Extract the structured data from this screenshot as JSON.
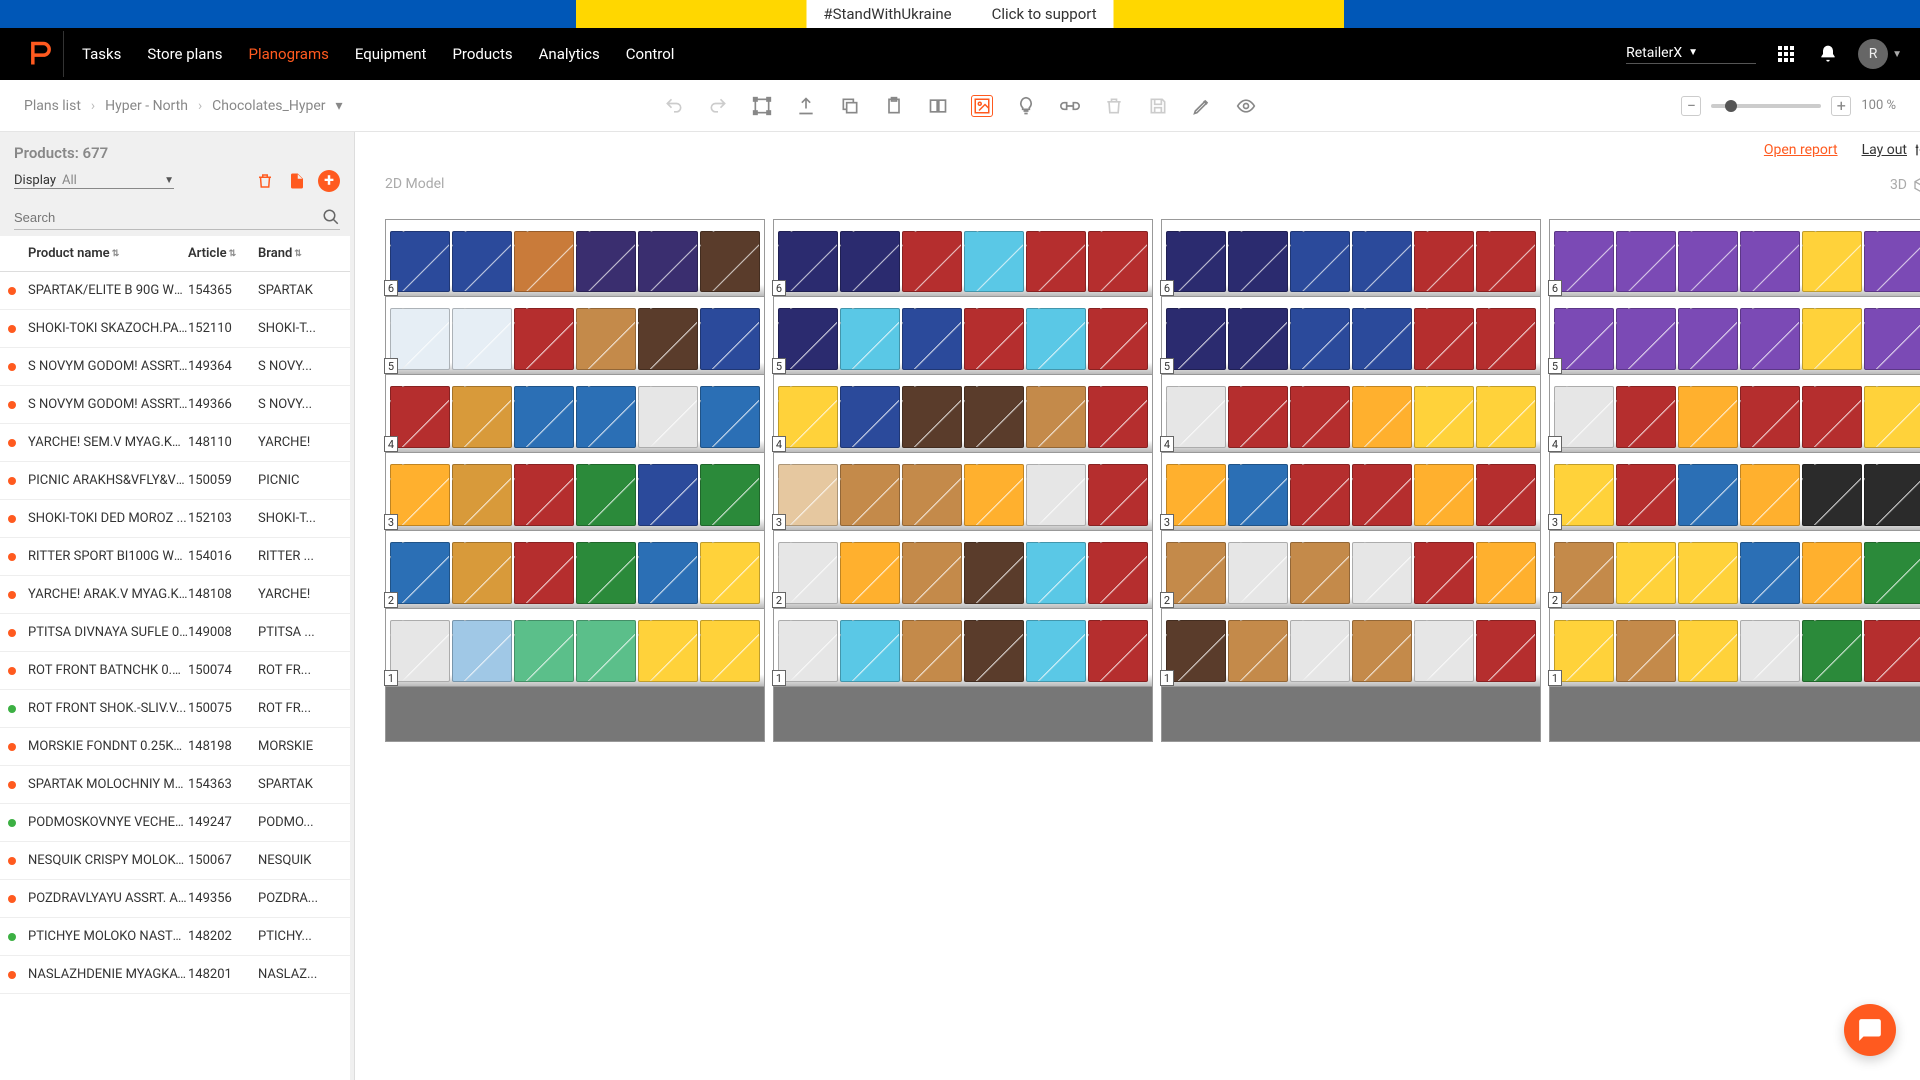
{
  "banner": {
    "hashtag": "#StandWithUkraine",
    "support": "Click to support"
  },
  "nav": {
    "items": [
      "Tasks",
      "Store plans",
      "Planograms",
      "Equipment",
      "Products",
      "Analytics",
      "Control"
    ],
    "active": "Planograms",
    "retailer": "RetailerX",
    "avatar_initial": "R"
  },
  "breadcrumb": {
    "a": "Plans list",
    "b": "Hyper - North",
    "c": "Chocolates_Hyper"
  },
  "zoom": {
    "percent": "100 %"
  },
  "sidebar": {
    "title": "Products: 677",
    "display_label": "Display",
    "display_value": "All",
    "search_placeholder": "Search",
    "headers": {
      "name": "Product name",
      "article": "Article",
      "brand": "Brand"
    },
    "rows": [
      {
        "c": "o",
        "name": "SPARTAK/ELITE B 90G WP...",
        "article": "154365",
        "brand": "SPARTAK"
      },
      {
        "c": "o",
        "name": "SHOKI-TOKI SKAZOCH.PA...",
        "article": "152110",
        "brand": "SHOKI-T..."
      },
      {
        "c": "o",
        "name": "S NOVYM GODOM! ASSRT...",
        "article": "149364",
        "brand": "S NOVY..."
      },
      {
        "c": "o",
        "name": "S NOVYM GODOM! ASSRT...",
        "article": "149366",
        "brand": "S NOVY..."
      },
      {
        "c": "o",
        "name": "YARCHE! SEM.V MYAG.KA...",
        "article": "148110",
        "brand": "YARCHE!"
      },
      {
        "c": "o",
        "name": "PICNIC ARAKHS&VFLY&VZ...",
        "article": "150059",
        "brand": "PICNIC"
      },
      {
        "c": "o",
        "name": "SHOKI-TOKI DED MOROZ ...",
        "article": "152103",
        "brand": "SHOKI-T..."
      },
      {
        "c": "o",
        "name": "RITTER SPORT BI100G WS...",
        "article": "154016",
        "brand": "RITTER ..."
      },
      {
        "c": "o",
        "name": "YARCHE! ARAK.V MYAG.K...",
        "article": "148108",
        "brand": "YARCHE!"
      },
      {
        "c": "o",
        "name": "PTITSA DIVNAYA SUFLE 0...",
        "article": "149008",
        "brand": "PTITSA ..."
      },
      {
        "c": "o",
        "name": "ROT FRONT BATNCHK 0.2...",
        "article": "150074",
        "brand": "ROT FR..."
      },
      {
        "c": "g",
        "name": "ROT FRONT SHOK.-SLIV.V...",
        "article": "150075",
        "brand": "ROT FR..."
      },
      {
        "c": "o",
        "name": "MORSKIE FONDNT 0.25KG...",
        "article": "148198",
        "brand": "MORSKIE"
      },
      {
        "c": "o",
        "name": "SPARTAK MOLOCHNIY MC...",
        "article": "154363",
        "brand": "SPARTAK"
      },
      {
        "c": "g",
        "name": "PODMOSKOVNYE VECHER...",
        "article": "149247",
        "brand": "PODMO..."
      },
      {
        "c": "o",
        "name": "NESQUIK CRISPY MOLOKO...",
        "article": "150067",
        "brand": "NESQUIK"
      },
      {
        "c": "o",
        "name": "POZDRAVLYAYU ASSRT. A...",
        "article": "149356",
        "brand": "POZDRA..."
      },
      {
        "c": "g",
        "name": "PTICHYE MOLOKO NASTO...",
        "article": "148202",
        "brand": "PTICHY..."
      },
      {
        "c": "o",
        "name": "NASLAZHDENIE MYAGKAY...",
        "article": "148201",
        "brand": "NASLAZ..."
      }
    ]
  },
  "canvas": {
    "open_report": "Open report",
    "layout": "Lay out",
    "mode2d": "2D Model",
    "mode3d": "3D",
    "shelf_levels": [
      6,
      5,
      4,
      3,
      2,
      1
    ],
    "gondola_count": 4,
    "palettes": {
      "0": [
        [
          "#2b4a9b",
          "#2b4a9b",
          "#c97b3a",
          "#3a2e6f",
          "#3a2e6f",
          "#5a3c2b"
        ],
        [
          "#e6eef5",
          "#e6eef5",
          "#b52e2e",
          "#c48a4a",
          "#5a3c2b",
          "#2b4a9b"
        ],
        [
          "#b52e2e",
          "#d89a3a",
          "#2b6fb5",
          "#2b6fb5",
          "#e6e6e6",
          "#2b6fb5"
        ],
        [
          "#ffb02e",
          "#d89a3a",
          "#b52e2e",
          "#2b8a3a",
          "#2b4a9b",
          "#2b8a3a"
        ],
        [
          "#2b6fb5",
          "#d89a3a",
          "#b52e2e",
          "#2b8a3a",
          "#2b6fb5",
          "#ffd23a"
        ],
        [
          "#e6e6e6",
          "#a0c8e6",
          "#5bbf8a",
          "#5bbf8a",
          "#ffd23a",
          "#ffd23a"
        ]
      ],
      "1": [
        [
          "#2b2b6f",
          "#2b2b6f",
          "#b52e2e",
          "#5ac8e6",
          "#b52e2e",
          "#b52e2e"
        ],
        [
          "#2b2b6f",
          "#5ac8e6",
          "#2b4a9b",
          "#b52e2e",
          "#5ac8e6",
          "#b52e2e"
        ],
        [
          "#ffd23a",
          "#2b4a9b",
          "#5a3c2b",
          "#5a3c2b",
          "#c48a4a",
          "#b52e2e"
        ],
        [
          "#e6c8a0",
          "#c48a4a",
          "#c48a4a",
          "#ffb02e",
          "#e6e6e6",
          "#b52e2e"
        ],
        [
          "#e6e6e6",
          "#ffb02e",
          "#c48a4a",
          "#5a3c2b",
          "#5ac8e6",
          "#b52e2e"
        ],
        [
          "#e6e6e6",
          "#5ac8e6",
          "#c48a4a",
          "#5a3c2b",
          "#5ac8e6",
          "#b52e2e"
        ]
      ],
      "2": [
        [
          "#2b2b6f",
          "#2b2b6f",
          "#2b4a9b",
          "#2b4a9b",
          "#b52e2e",
          "#b52e2e"
        ],
        [
          "#2b2b6f",
          "#2b2b6f",
          "#2b4a9b",
          "#2b4a9b",
          "#b52e2e",
          "#b52e2e"
        ],
        [
          "#e6e6e6",
          "#b52e2e",
          "#b52e2e",
          "#ffb02e",
          "#ffd23a",
          "#ffd23a"
        ],
        [
          "#ffb02e",
          "#2b6fb5",
          "#b52e2e",
          "#b52e2e",
          "#ffb02e",
          "#b52e2e"
        ],
        [
          "#c48a4a",
          "#e6e6e6",
          "#c48a4a",
          "#e6e6e6",
          "#b52e2e",
          "#ffb02e"
        ],
        [
          "#5a3c2b",
          "#c48a4a",
          "#e6e6e6",
          "#c48a4a",
          "#e6e6e6",
          "#b52e2e"
        ]
      ],
      "3": [
        [
          "#7b4ab5",
          "#7b4ab5",
          "#7b4ab5",
          "#7b4ab5",
          "#ffd23a",
          "#7b4ab5"
        ],
        [
          "#7b4ab5",
          "#7b4ab5",
          "#7b4ab5",
          "#7b4ab5",
          "#ffd23a",
          "#7b4ab5"
        ],
        [
          "#e6e6e6",
          "#b52e2e",
          "#ffb02e",
          "#b52e2e",
          "#b52e2e",
          "#ffd23a"
        ],
        [
          "#ffd23a",
          "#b52e2e",
          "#2b6fb5",
          "#ffb02e",
          "#2b2b2b",
          "#2b2b2b"
        ],
        [
          "#c48a4a",
          "#ffd23a",
          "#ffd23a",
          "#2b6fb5",
          "#ffb02e",
          "#2b8a3a"
        ],
        [
          "#ffd23a",
          "#c48a4a",
          "#ffd23a",
          "#e6e6e6",
          "#2b8a3a",
          "#b52e2e"
        ]
      ]
    }
  }
}
